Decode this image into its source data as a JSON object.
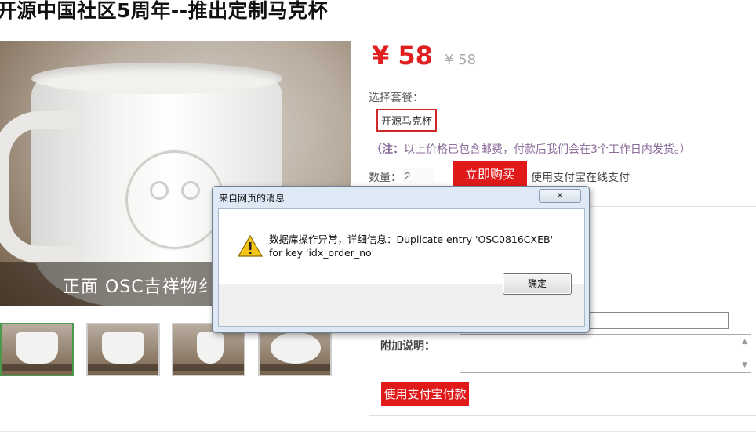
{
  "page": {
    "title": "开源中国社区5周年--推出定制马克杯"
  },
  "photo": {
    "caption": "正面 OSC吉祥物纟"
  },
  "thumbnails": {
    "count": 4,
    "active_index": 0
  },
  "product": {
    "price_current": "¥ 58",
    "price_original": "¥ 58",
    "package_label": "选择套餐：",
    "package_option": "开源马克杯",
    "note_prefix": "（注：",
    "note_text": "以上价格已包含邮费，付款后我们会在3个工作日内发货。）",
    "quantity_label": "数量：",
    "quantity_value": "2",
    "buy_button": "立即购买",
    "alipay_online": "使用支付宝在线支付"
  },
  "order_form": {
    "note_label": "附加说明：",
    "pay_button": "使用支付宝付款"
  },
  "dialog": {
    "title": "来自网页的消息",
    "close_glyph": "✕",
    "message": "数据库操作异常，详细信息：Duplicate entry 'OSC0816CXEB' for key 'idx_order_no'",
    "ok_button": "确定",
    "icon": "warning-icon"
  },
  "colors": {
    "accent_red": "#e01a1a",
    "note_purple": "#8a6b9a",
    "dialog_frame": "#dfe9f5"
  }
}
